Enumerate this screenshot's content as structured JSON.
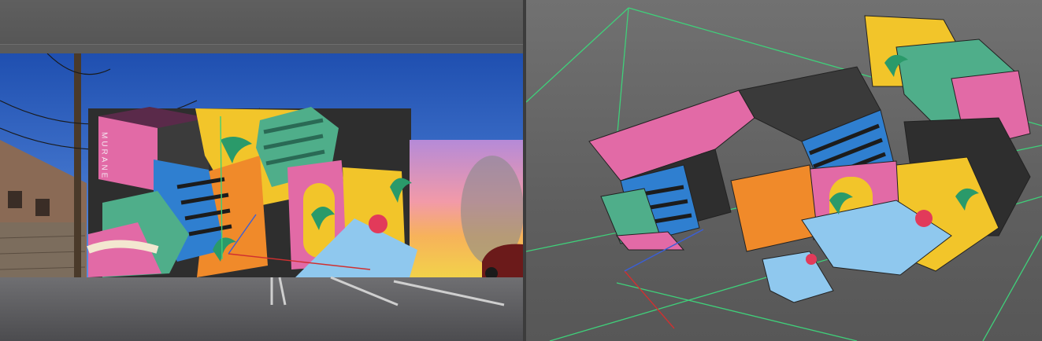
{
  "app": {
    "left_panel": "source-photo-viewer",
    "right_panel": "3d-viewport"
  },
  "photo": {
    "wall_lettering": "MURANE"
  },
  "colors": {
    "sky": "#2a5bbf",
    "mural_pink": "#e26aa6",
    "mural_yellow": "#f2c52a",
    "mural_orange": "#f08a2a",
    "mural_green": "#4fae8a",
    "mural_blue": "#2f7fd0",
    "mural_dark": "#2e2e2e",
    "camera_frustum": "#3fd07a",
    "axis_x": "#d03030",
    "axis_y": "#3a5fd8"
  }
}
